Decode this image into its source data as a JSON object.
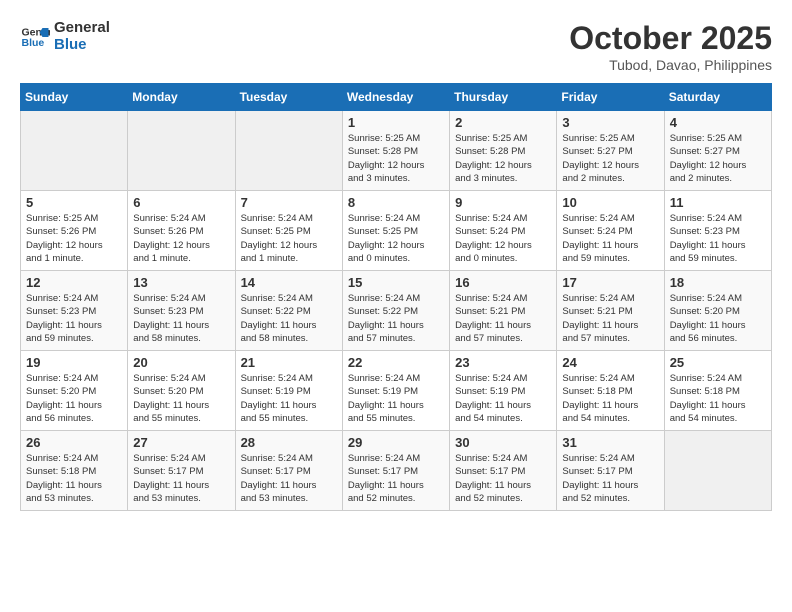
{
  "logo": {
    "line1": "General",
    "line2": "Blue"
  },
  "title": "October 2025",
  "subtitle": "Tubod, Davao, Philippines",
  "days_of_week": [
    "Sunday",
    "Monday",
    "Tuesday",
    "Wednesday",
    "Thursday",
    "Friday",
    "Saturday"
  ],
  "weeks": [
    [
      {
        "day": "",
        "info": ""
      },
      {
        "day": "",
        "info": ""
      },
      {
        "day": "",
        "info": ""
      },
      {
        "day": "1",
        "info": "Sunrise: 5:25 AM\nSunset: 5:28 PM\nDaylight: 12 hours\nand 3 minutes."
      },
      {
        "day": "2",
        "info": "Sunrise: 5:25 AM\nSunset: 5:28 PM\nDaylight: 12 hours\nand 3 minutes."
      },
      {
        "day": "3",
        "info": "Sunrise: 5:25 AM\nSunset: 5:27 PM\nDaylight: 12 hours\nand 2 minutes."
      },
      {
        "day": "4",
        "info": "Sunrise: 5:25 AM\nSunset: 5:27 PM\nDaylight: 12 hours\nand 2 minutes."
      }
    ],
    [
      {
        "day": "5",
        "info": "Sunrise: 5:25 AM\nSunset: 5:26 PM\nDaylight: 12 hours\nand 1 minute."
      },
      {
        "day": "6",
        "info": "Sunrise: 5:24 AM\nSunset: 5:26 PM\nDaylight: 12 hours\nand 1 minute."
      },
      {
        "day": "7",
        "info": "Sunrise: 5:24 AM\nSunset: 5:25 PM\nDaylight: 12 hours\nand 1 minute."
      },
      {
        "day": "8",
        "info": "Sunrise: 5:24 AM\nSunset: 5:25 PM\nDaylight: 12 hours\nand 0 minutes."
      },
      {
        "day": "9",
        "info": "Sunrise: 5:24 AM\nSunset: 5:24 PM\nDaylight: 12 hours\nand 0 minutes."
      },
      {
        "day": "10",
        "info": "Sunrise: 5:24 AM\nSunset: 5:24 PM\nDaylight: 11 hours\nand 59 minutes."
      },
      {
        "day": "11",
        "info": "Sunrise: 5:24 AM\nSunset: 5:23 PM\nDaylight: 11 hours\nand 59 minutes."
      }
    ],
    [
      {
        "day": "12",
        "info": "Sunrise: 5:24 AM\nSunset: 5:23 PM\nDaylight: 11 hours\nand 59 minutes."
      },
      {
        "day": "13",
        "info": "Sunrise: 5:24 AM\nSunset: 5:23 PM\nDaylight: 11 hours\nand 58 minutes."
      },
      {
        "day": "14",
        "info": "Sunrise: 5:24 AM\nSunset: 5:22 PM\nDaylight: 11 hours\nand 58 minutes."
      },
      {
        "day": "15",
        "info": "Sunrise: 5:24 AM\nSunset: 5:22 PM\nDaylight: 11 hours\nand 57 minutes."
      },
      {
        "day": "16",
        "info": "Sunrise: 5:24 AM\nSunset: 5:21 PM\nDaylight: 11 hours\nand 57 minutes."
      },
      {
        "day": "17",
        "info": "Sunrise: 5:24 AM\nSunset: 5:21 PM\nDaylight: 11 hours\nand 57 minutes."
      },
      {
        "day": "18",
        "info": "Sunrise: 5:24 AM\nSunset: 5:20 PM\nDaylight: 11 hours\nand 56 minutes."
      }
    ],
    [
      {
        "day": "19",
        "info": "Sunrise: 5:24 AM\nSunset: 5:20 PM\nDaylight: 11 hours\nand 56 minutes."
      },
      {
        "day": "20",
        "info": "Sunrise: 5:24 AM\nSunset: 5:20 PM\nDaylight: 11 hours\nand 55 minutes."
      },
      {
        "day": "21",
        "info": "Sunrise: 5:24 AM\nSunset: 5:19 PM\nDaylight: 11 hours\nand 55 minutes."
      },
      {
        "day": "22",
        "info": "Sunrise: 5:24 AM\nSunset: 5:19 PM\nDaylight: 11 hours\nand 55 minutes."
      },
      {
        "day": "23",
        "info": "Sunrise: 5:24 AM\nSunset: 5:19 PM\nDaylight: 11 hours\nand 54 minutes."
      },
      {
        "day": "24",
        "info": "Sunrise: 5:24 AM\nSunset: 5:18 PM\nDaylight: 11 hours\nand 54 minutes."
      },
      {
        "day": "25",
        "info": "Sunrise: 5:24 AM\nSunset: 5:18 PM\nDaylight: 11 hours\nand 54 minutes."
      }
    ],
    [
      {
        "day": "26",
        "info": "Sunrise: 5:24 AM\nSunset: 5:18 PM\nDaylight: 11 hours\nand 53 minutes."
      },
      {
        "day": "27",
        "info": "Sunrise: 5:24 AM\nSunset: 5:17 PM\nDaylight: 11 hours\nand 53 minutes."
      },
      {
        "day": "28",
        "info": "Sunrise: 5:24 AM\nSunset: 5:17 PM\nDaylight: 11 hours\nand 53 minutes."
      },
      {
        "day": "29",
        "info": "Sunrise: 5:24 AM\nSunset: 5:17 PM\nDaylight: 11 hours\nand 52 minutes."
      },
      {
        "day": "30",
        "info": "Sunrise: 5:24 AM\nSunset: 5:17 PM\nDaylight: 11 hours\nand 52 minutes."
      },
      {
        "day": "31",
        "info": "Sunrise: 5:24 AM\nSunset: 5:17 PM\nDaylight: 11 hours\nand 52 minutes."
      },
      {
        "day": "",
        "info": ""
      }
    ]
  ]
}
